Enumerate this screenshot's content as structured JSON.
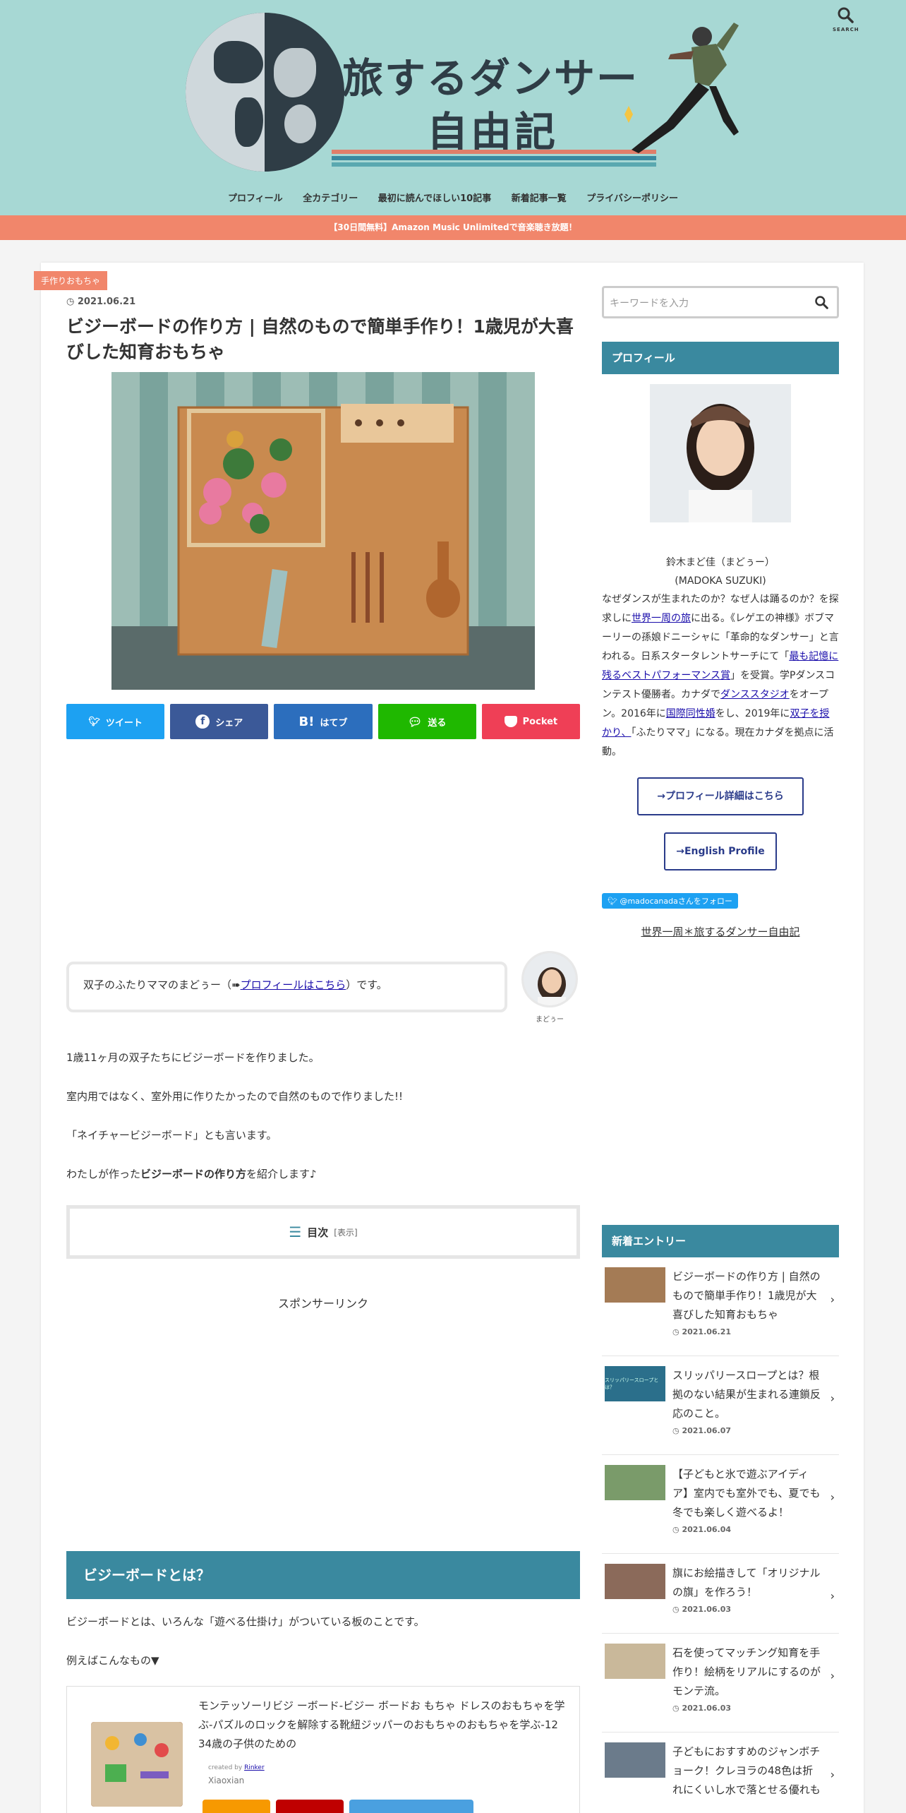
{
  "header": {
    "title_line1": "旅するダンサー",
    "title_line2": "自由記",
    "search_label": "SEARCH",
    "stripe_colors": [
      "#e07e6a",
      "#3a899f",
      "#5aa8b0"
    ]
  },
  "nav": [
    "プロフィール",
    "全カテゴリー",
    "最初に読んでほしい10記事",
    "新着記事一覧",
    "プライバシーポリシー"
  ],
  "notice": "【30日間無料】Amazon Music Unlimitedで音楽聴き放題！",
  "article": {
    "category": "手作りおもちゃ",
    "date": "2021.06.21",
    "title": "ビジーボードの作り方 | 自然のもので簡単手作り！1歳児が大喜びした知育おもちゃ",
    "share": [
      {
        "label": "ツイート",
        "color": "#1da1f2",
        "icon": "twitter-icon"
      },
      {
        "label": "シェア",
        "color": "#3b5998",
        "icon": "facebook-icon"
      },
      {
        "label": "はてブ",
        "color": "#2c6ebd",
        "icon": "hatena-icon"
      },
      {
        "label": "送る",
        "color": "#1fb800",
        "icon": "line-icon"
      },
      {
        "label": "Pocket",
        "color": "#ef3f56",
        "icon": "pocket-icon"
      }
    ],
    "balloon_pre": "双子のふたりママのまどぅー（➠",
    "balloon_link": "プロフィールはこちら",
    "balloon_post": "）です。",
    "balloon_name": "まどぅー",
    "paragraphs": [
      "1歳11ヶ月の双子たちにビジーボードを作りました。",
      "室内用ではなく、室外用に作りたかったので自然のもので作りました!!",
      "「ネイチャービジーボード」とも言います。"
    ],
    "para4_pre": "わたしが作った",
    "para4_bold": "ビジーボードの作り方",
    "para4_post": "を紹介します♪",
    "toc_label": "目次",
    "toc_toggle": "[表示]",
    "sponsor": "スポンサーリンク",
    "h2": "ビジーボードとは？",
    "h2_para1": "ビジーボードとは、いろんな「遊べる仕掛け」がついている板のことです。",
    "h2_para2": "例えばこんなもの▼",
    "product": {
      "title": "モンテッソーリビジ ーボード-ビジー ボードお もちゃ ドレスのおもちゃを学ぶ-パズルのロックを解除する靴紐ジッパーのおもちゃのおもちゃを学ぶ-12 34歳の子供のための",
      "credit_pre": "created by",
      "credit_link": "Rinker",
      "brand": "Xiaoxian",
      "button_colors": [
        "#f79901",
        "#bf0000",
        "#4aa0e0"
      ]
    }
  },
  "sidebar": {
    "search_placeholder": "キーワードを入力",
    "profile_heading": "プロフィール",
    "profile_name": "鈴木まど佳（まどぅー）",
    "profile_name_en": "(MADOKA SUZUKI)",
    "profile_text": [
      {
        "t": "なぜダンスが生まれたのか？なぜ人は踊るのか？を探求しに"
      },
      {
        "t": "世界一周の旅",
        "link": true
      },
      {
        "t": "に出る。《レゲエの神様》ボブマーリーの孫娘ドニーシャに「革命的なダンサー」と言われる。日系スタータレントサーチにて「"
      },
      {
        "t": "最も記憶に残るベストパフォーマンス賞",
        "link": true
      },
      {
        "t": "」を受賞。学Pダンスコンテスト優勝者。カナダで"
      },
      {
        "t": "ダンススタジオ",
        "link": true
      },
      {
        "t": "をオープン。2016年に"
      },
      {
        "t": "国際同性婚",
        "link": true
      },
      {
        "t": "をし、2019年に"
      },
      {
        "t": "双子を授かり、",
        "link": true
      },
      {
        "t": "「ふたりママ」になる。現在カナダを拠点に活動。"
      }
    ],
    "btn_profile": "→プロフィール詳細はこちら",
    "btn_english": "→English Profile",
    "follow": "@madocanadaさんをフォロー",
    "link": "世界一周＊旅するダンサー自由記",
    "new_heading": "新着エントリー",
    "entries": [
      {
        "title": "ビジーボードの作り方 | 自然のもので簡単手作り！1歳児が大喜びした知育おもちゃ",
        "date": "2021.06.21",
        "color": "#a47b55"
      },
      {
        "title": "スリッパリースロープとは？根拠のない結果が生まれる連鎖反応のこと。",
        "date": "2021.06.07",
        "color": "#2b6f8b",
        "thumb_text": "スリッパリースロープとは？"
      },
      {
        "title": "【子どもと氷で遊ぶアイディア】室内でも室外でも、夏でも冬でも楽しく遊べるよ！",
        "date": "2021.06.04",
        "color": "#7a9b6a"
      },
      {
        "title": "旗にお絵描きして「オリジナルの旗」を作ろう！",
        "date": "2021.06.03",
        "color": "#8b6a5a"
      },
      {
        "title": "石を使ってマッチング知育を手作り！絵柄をリアルにするのがモンテ流。",
        "date": "2021.06.03",
        "color": "#c9b89a"
      },
      {
        "title": "子どもにおすすめのジャンボチョーク！クレヨラの48色は折れにくいし水で落とせる優れも",
        "date": "",
        "color": "#6b7b8b"
      }
    ]
  }
}
